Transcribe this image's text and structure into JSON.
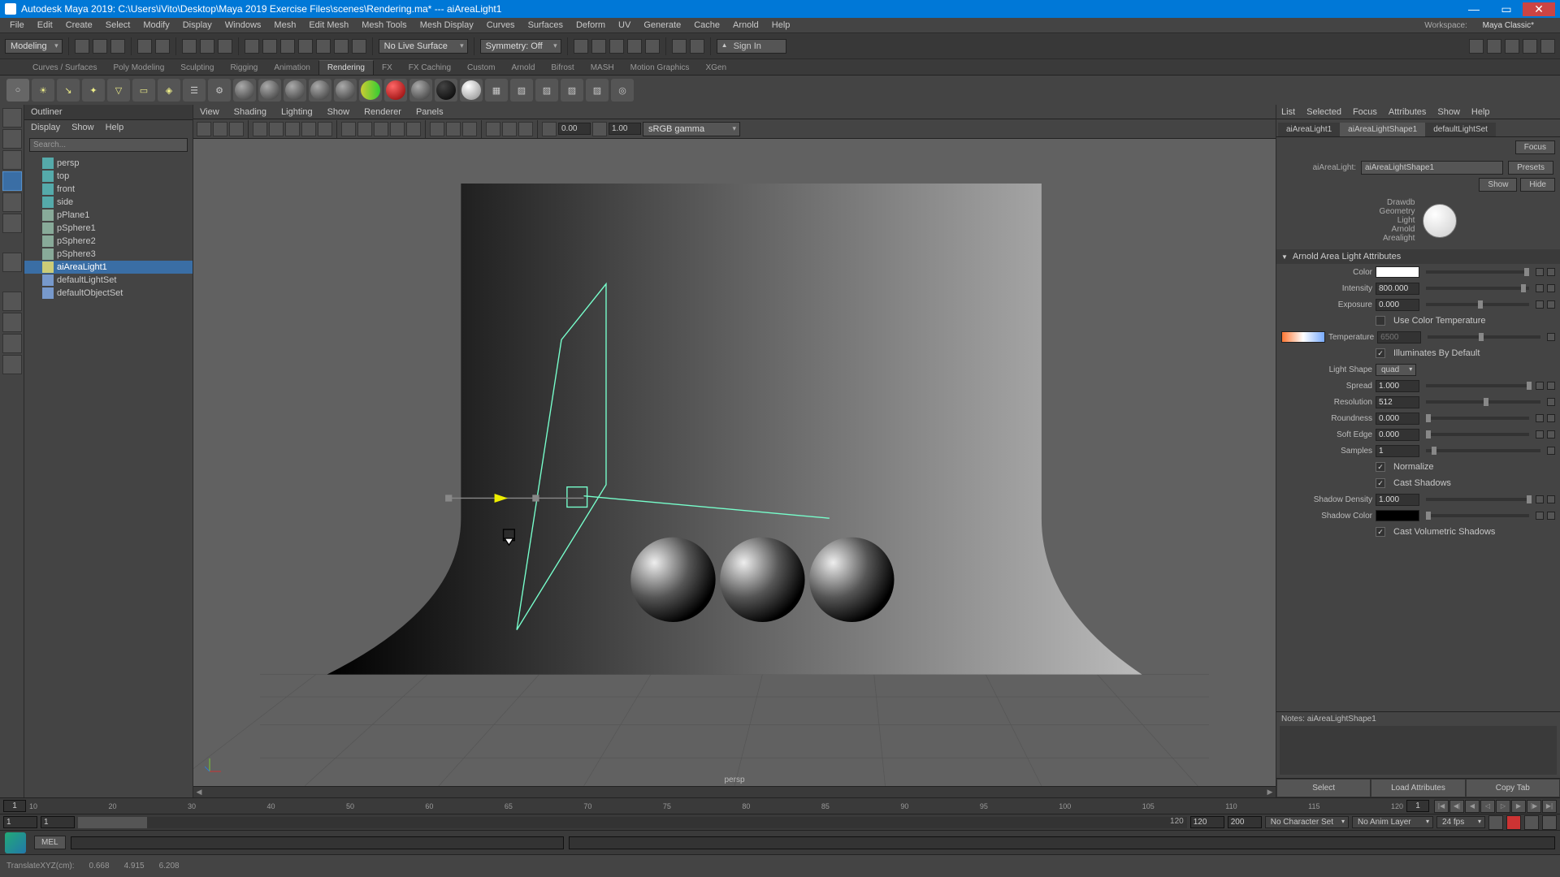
{
  "title": "Autodesk Maya 2019: C:\\Users\\iVito\\Desktop\\Maya 2019 Exercise Files\\scenes\\Rendering.ma*  ---  aiAreaLight1",
  "menubar": [
    "File",
    "Edit",
    "Create",
    "Select",
    "Modify",
    "Display",
    "Windows",
    "Mesh",
    "Edit Mesh",
    "Mesh Tools",
    "Mesh Display",
    "Curves",
    "Surfaces",
    "Deform",
    "UV",
    "Generate",
    "Cache",
    "Arnold",
    "Help"
  ],
  "workspace_label": "Workspace:",
  "workspace_value": "Maya Classic*",
  "modeDropdown": "Modeling",
  "liveSurface": "No Live Surface",
  "symmetry": "Symmetry: Off",
  "signin": "Sign In",
  "shelves": [
    "Curves / Surfaces",
    "Poly Modeling",
    "Sculpting",
    "Rigging",
    "Animation",
    "Rendering",
    "FX",
    "FX Caching",
    "Custom",
    "Arnold",
    "Bifrost",
    "MASH",
    "Motion Graphics",
    "XGen"
  ],
  "activeShelf": "Rendering",
  "outliner": {
    "title": "Outliner",
    "menus": [
      "Display",
      "Show",
      "Help"
    ],
    "search": "Search...",
    "nodes": [
      {
        "label": "persp",
        "type": "cam"
      },
      {
        "label": "top",
        "type": "cam"
      },
      {
        "label": "front",
        "type": "cam"
      },
      {
        "label": "side",
        "type": "cam"
      },
      {
        "label": "pPlane1",
        "type": "mesh"
      },
      {
        "label": "pSphere1",
        "type": "mesh"
      },
      {
        "label": "pSphere2",
        "type": "mesh"
      },
      {
        "label": "pSphere3",
        "type": "mesh"
      },
      {
        "label": "aiAreaLight1",
        "type": "light",
        "sel": true
      },
      {
        "label": "defaultLightSet",
        "type": "set"
      },
      {
        "label": "defaultObjectSet",
        "type": "set"
      }
    ]
  },
  "viewport": {
    "menus": [
      "View",
      "Shading",
      "Lighting",
      "Show",
      "Renderer",
      "Panels"
    ],
    "num1": "0.00",
    "num2": "1.00",
    "colormgmt": "sRGB gamma",
    "camera": "persp"
  },
  "ae": {
    "menus": [
      "List",
      "Selected",
      "Focus",
      "Attributes",
      "Show",
      "Help"
    ],
    "tabs": [
      "aiAreaLight1",
      "aiAreaLightShape1",
      "defaultLightSet"
    ],
    "activeTab": "aiAreaLightShape1",
    "focus": "Focus",
    "presets": "Presets",
    "show": "Show",
    "hide": "Hide",
    "nodeType": "aiAreaLight:",
    "nodeName": "aiAreaLightShape1",
    "swatchLabels": [
      "Drawdb",
      "Geometry",
      "Light",
      "Arnold",
      "Arealight"
    ],
    "section": "Arnold Area Light Attributes",
    "attrs": {
      "color": "Color",
      "intensity": {
        "l": "Intensity",
        "v": "800.000"
      },
      "exposure": {
        "l": "Exposure",
        "v": "0.000"
      },
      "usect": "Use Color Temperature",
      "temperature": {
        "l": "Temperature",
        "v": "6500"
      },
      "illum": "Illuminates By Default",
      "lightshape": {
        "l": "Light Shape",
        "v": "quad"
      },
      "spread": {
        "l": "Spread",
        "v": "1.000"
      },
      "resolution": {
        "l": "Resolution",
        "v": "512"
      },
      "roundness": {
        "l": "Roundness",
        "v": "0.000"
      },
      "softedge": {
        "l": "Soft Edge",
        "v": "0.000"
      },
      "samples": {
        "l": "Samples",
        "v": "1"
      },
      "normalize": "Normalize",
      "castshadows": "Cast Shadows",
      "shadowdensity": {
        "l": "Shadow Density",
        "v": "1.000"
      },
      "shadowcolor": "Shadow Color",
      "castvol": "Cast Volumetric Shadows"
    },
    "notes_label": "Notes:",
    "notes_node": "aiAreaLightShape1",
    "btn_select": "Select",
    "btn_load": "Load Attributes",
    "btn_copy": "Copy Tab"
  },
  "timeline": {
    "start": "1",
    "end": "1",
    "rstart": "1",
    "rend": "1",
    "ticks": [
      "10",
      "20",
      "30",
      "40",
      "50",
      "60",
      "65",
      "70",
      "75",
      "80",
      "85",
      "90",
      "95",
      "100",
      "105",
      "110",
      "115",
      "120"
    ],
    "rangeA": "1",
    "rangeAlabel": "1",
    "rangeMid": "120",
    "rangeB": "120",
    "rangeC": "200",
    "nochar": "No Character Set",
    "noanim": "No Anim Layer",
    "fps": "24 fps"
  },
  "cmd": {
    "lang": "MEL"
  },
  "helpline": {
    "label": "TranslateXYZ(cm):",
    "x": "0.668",
    "y": "4.915",
    "z": "6.208"
  }
}
